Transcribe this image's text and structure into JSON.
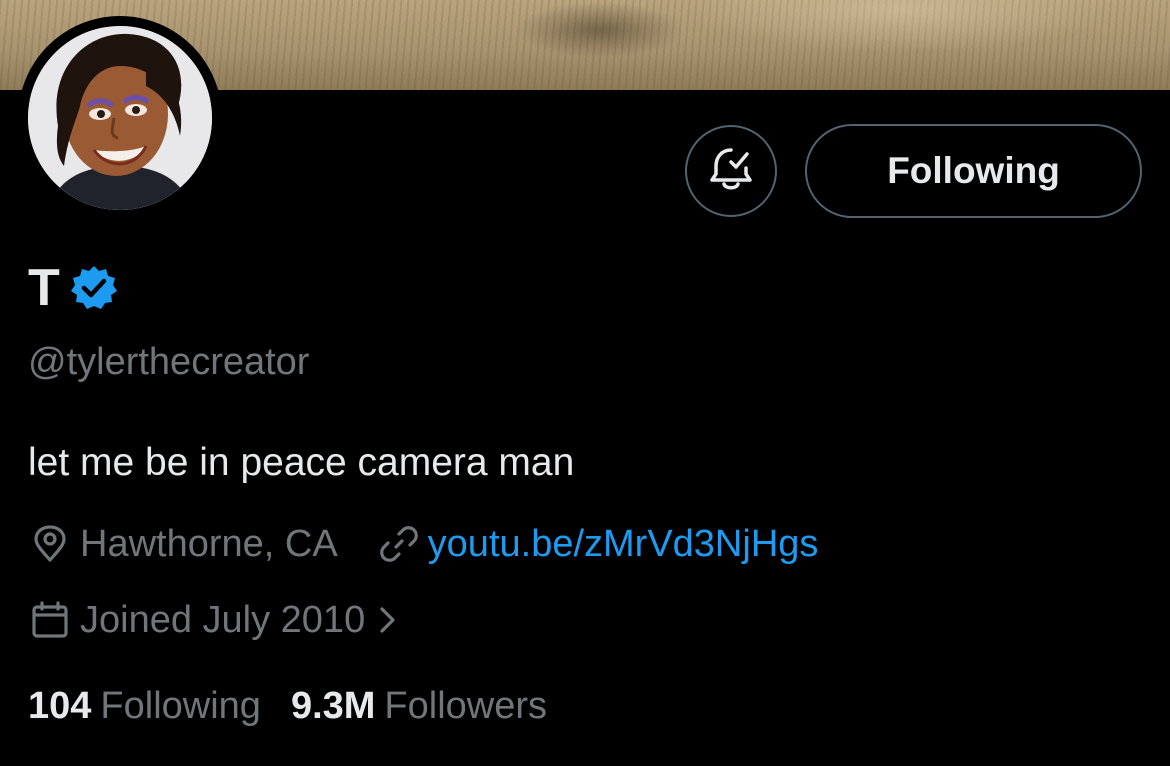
{
  "profile": {
    "display_name": "T",
    "handle": "@tylerthecreator",
    "bio": "let me be in peace camera man",
    "location": "Hawthorne, CA",
    "website": "youtu.be/zMrVd3NjHgs",
    "joined": "Joined July 2010",
    "verified": true
  },
  "actions": {
    "follow_label": "Following",
    "notify_icon": "bell-check-icon"
  },
  "stats": {
    "following_count": "104",
    "following_label": "Following",
    "followers_count": "9.3M",
    "followers_label": "Followers"
  },
  "colors": {
    "background": "#000000",
    "text_primary": "#e7e9ea",
    "text_secondary": "#71767b",
    "link": "#1d9bf0",
    "verified_badge": "#1d9bf0",
    "button_border": "#536471"
  }
}
